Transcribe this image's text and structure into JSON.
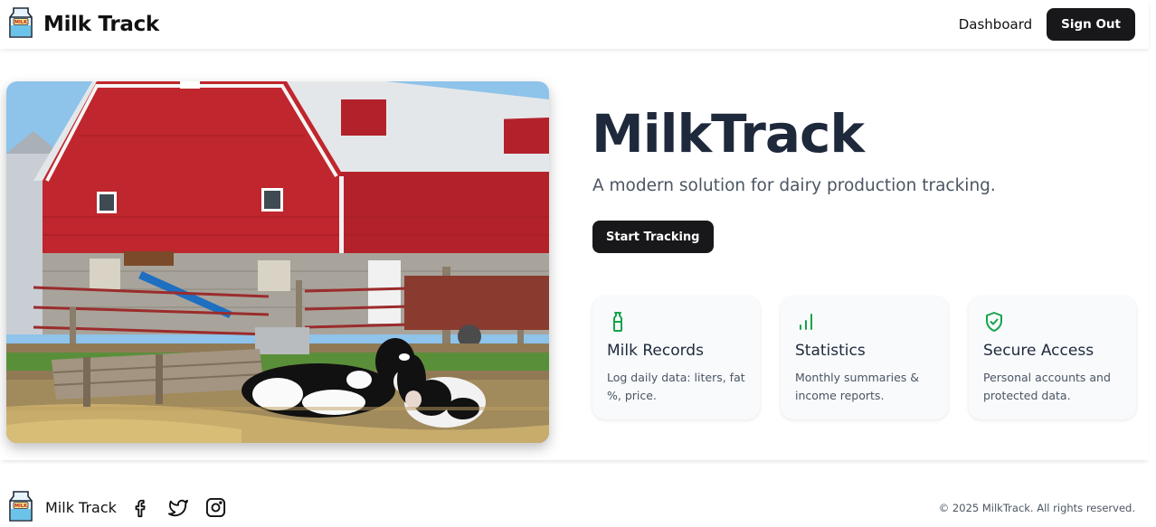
{
  "header": {
    "brand": "Milk Track",
    "nav_dashboard": "Dashboard",
    "signout_label": "Sign Out"
  },
  "hero": {
    "title": "MilkTrack",
    "subtitle": "A modern solution for dairy production tracking.",
    "cta_label": "Start Tracking"
  },
  "features": [
    {
      "icon": "milk-bottle-icon",
      "title": "Milk Records",
      "desc": "Log daily data: liters, fat %, price."
    },
    {
      "icon": "bar-chart-icon",
      "title": "Statistics",
      "desc": "Monthly summaries & income reports."
    },
    {
      "icon": "shield-check-icon",
      "title": "Secure Access",
      "desc": "Personal accounts and protected data."
    }
  ],
  "footer": {
    "brand": "Milk Track",
    "social": [
      "facebook-icon",
      "twitter-icon",
      "instagram-icon"
    ],
    "copyright": "© 2025 MilkTrack. All rights reserved."
  },
  "colors": {
    "accent_green": "#16a34a",
    "button_dark": "#18181b",
    "heading": "#1e293b",
    "barn_red": "#c0262d"
  }
}
